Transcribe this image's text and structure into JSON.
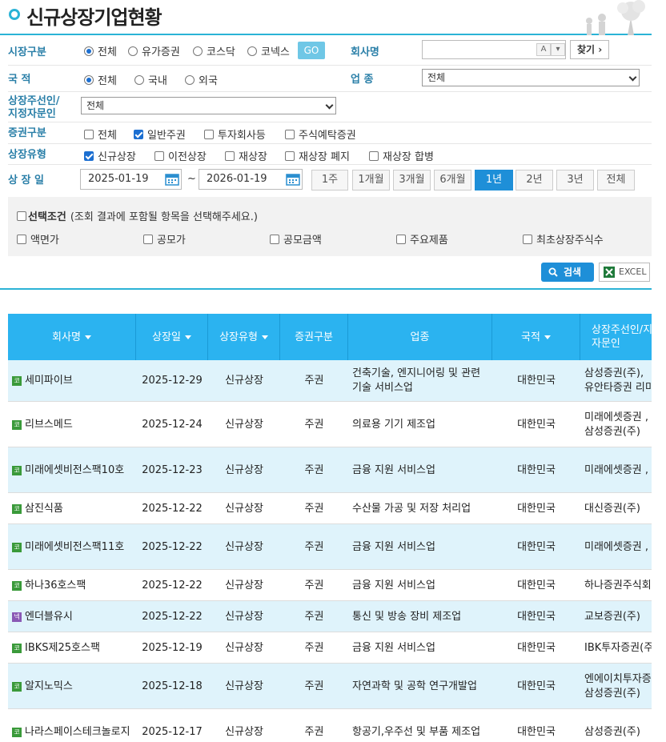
{
  "title": "신규상장기업현황",
  "filters": {
    "market": {
      "label": "시장구분",
      "options": [
        "전체",
        "유가증권",
        "코스닥",
        "코넥스"
      ],
      "selected_index": 0,
      "go_label": "GO"
    },
    "company": {
      "label": "회사명",
      "value": "",
      "btn_a": "A",
      "btn_arrow": "▾",
      "find_label": "찾기 ›"
    },
    "nation": {
      "label": "국 적",
      "options": [
        "전체",
        "국내",
        "외국"
      ],
      "selected_index": 0
    },
    "industry": {
      "label": "업 종",
      "value": "전체"
    },
    "underwriter": {
      "label_line1": "상장주선인/",
      "label_line2": "지정자문인",
      "value": "전체"
    },
    "security_type": {
      "label": "증권구분",
      "options": [
        "전체",
        "일반주권",
        "투자회사등",
        "주식예탁증권"
      ],
      "checked": [
        false,
        true,
        false,
        false
      ]
    },
    "listing_type": {
      "label": "상장유형",
      "options": [
        "신규상장",
        "이전상장",
        "재상장",
        "재상장 폐지",
        "재상장 합병"
      ],
      "checked": [
        true,
        false,
        false,
        false,
        false
      ]
    },
    "listing_date": {
      "label": "상 장 일",
      "from": "2025-01-19",
      "to": "2026-01-19",
      "separator": "~",
      "periods": [
        "1주",
        "1개월",
        "3개월",
        "6개월",
        "1년",
        "2년",
        "3년",
        "전체"
      ],
      "active_period": "1년"
    }
  },
  "conditions": {
    "title": "선택조건",
    "hint": "(조회 결과에 포함될 항목을 선택해주세요.)",
    "items": [
      "액면가",
      "공모가",
      "공모금액",
      "주요제품",
      "최초상장주식수"
    ]
  },
  "actions": {
    "search_label": "검색",
    "excel_label": "EXCEL"
  },
  "table": {
    "columns": [
      "회사명",
      "상장일",
      "상장유형",
      "증권구분",
      "업종",
      "국적",
      "상장주선인/지정자문인"
    ],
    "rows": [
      {
        "market_icon": "코",
        "name": "세미파이브",
        "date": "2025-12-29",
        "type": "신규상장",
        "sec": "주권",
        "industry": "건축기술, 엔지니어링 및 관련 기술 서비스업",
        "country": "대한민국",
        "underwriter": "삼성증권(주),유안타증권 리미티드"
      },
      {
        "market_icon": "코",
        "name": "리브스메드",
        "date": "2025-12-24",
        "type": "신규상장",
        "sec": "주권",
        "industry": "의료용 기기 제조업",
        "country": "대한민국",
        "underwriter": "미래에셋증권 ,삼성증권(주)"
      },
      {
        "market_icon": "코",
        "name": "미래에셋비전스팩10호",
        "date": "2025-12-23",
        "type": "신규상장",
        "sec": "주권",
        "industry": "금융 지원 서비스업",
        "country": "대한민국",
        "underwriter": "미래에셋증권 ,"
      },
      {
        "market_icon": "코",
        "name": "삼진식품",
        "date": "2025-12-22",
        "type": "신규상장",
        "sec": "주권",
        "industry": "수산물 가공 및 저장 처리업",
        "country": "대한민국",
        "underwriter": "대신증권(주)"
      },
      {
        "market_icon": "코",
        "name": "미래에셋비전스팩11호",
        "date": "2025-12-22",
        "type": "신규상장",
        "sec": "주권",
        "industry": "금융 지원 서비스업",
        "country": "대한민국",
        "underwriter": "미래에셋증권 ,"
      },
      {
        "market_icon": "코",
        "name": "하나36호스팩",
        "date": "2025-12-22",
        "type": "신규상장",
        "sec": "주권",
        "industry": "금융 지원 서비스업",
        "country": "대한민국",
        "underwriter": "하나증권주식회"
      },
      {
        "market_icon": "넥",
        "name": "엔더블유시",
        "date": "2025-12-22",
        "type": "신규상장",
        "sec": "주권",
        "industry": "통신 및 방송 장비 제조업",
        "country": "대한민국",
        "underwriter": "교보증권(주)"
      },
      {
        "market_icon": "코",
        "name": "IBKS제25호스팩",
        "date": "2025-12-19",
        "type": "신규상장",
        "sec": "주권",
        "industry": "금융 지원 서비스업",
        "country": "대한민국",
        "underwriter": "IBK투자증권(주"
      },
      {
        "market_icon": "코",
        "name": "알지노믹스",
        "date": "2025-12-18",
        "type": "신규상장",
        "sec": "주권",
        "industry": "자연과학 및 공학 연구개발업",
        "country": "대한민국",
        "underwriter": "엔에이치투자증,삼성증권(주)"
      },
      {
        "market_icon": "코",
        "name": "나라스페이스테크놀로지",
        "date": "2025-12-17",
        "type": "신규상장",
        "sec": "주권",
        "industry": "항공기,우주선 및 부품 제조업",
        "country": "대한민국",
        "underwriter": "삼성증권(주)"
      }
    ]
  }
}
